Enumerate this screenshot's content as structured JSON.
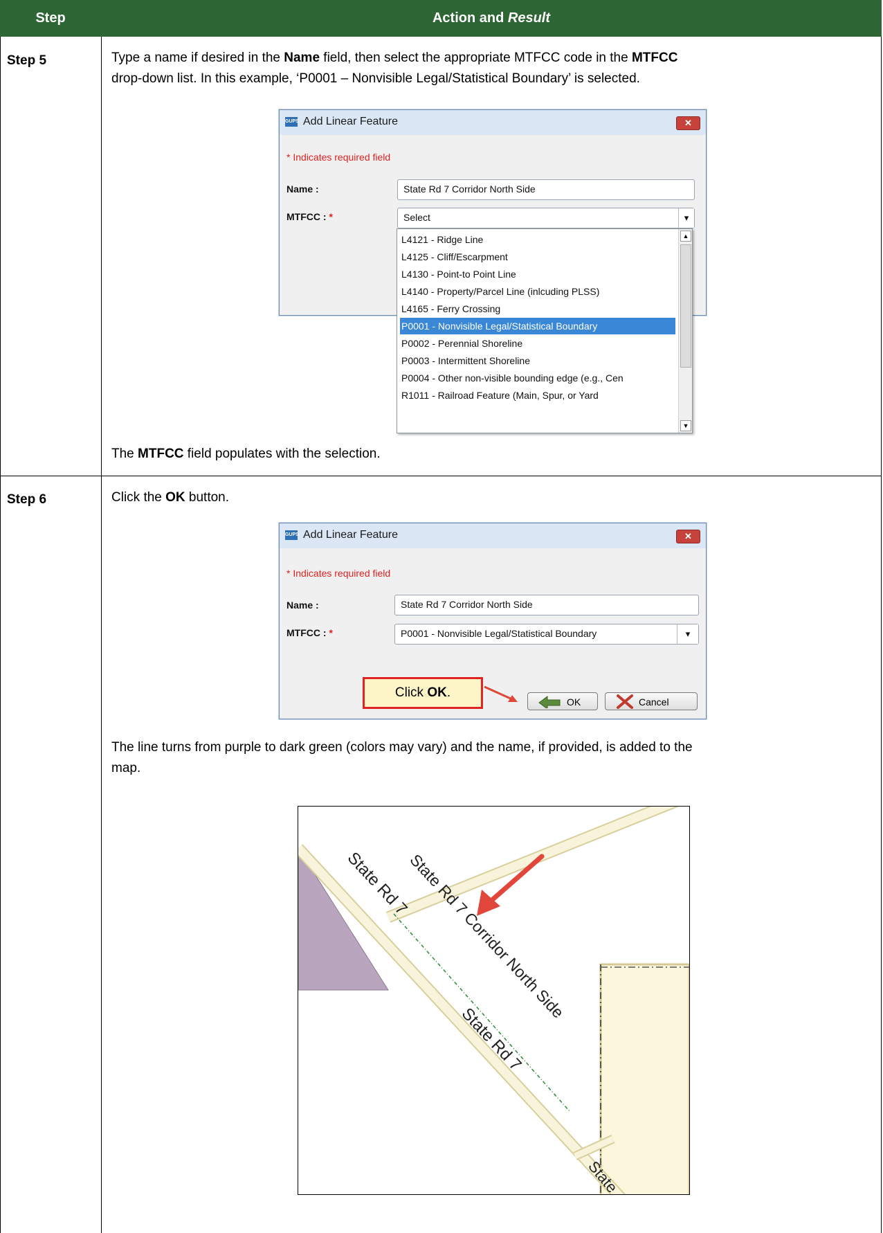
{
  "header": {
    "step": "Step",
    "action_prefix": "Action and ",
    "action_italic": "Result"
  },
  "step5": {
    "label": "Step 5",
    "para1_a": "Type a name if desired in the ",
    "para1_b": "Name",
    "para1_c": " field, then select the appropriate MTFCC code in the ",
    "para1_d": "MTFCC",
    "para1_e": "drop-down list. In this example, ‘P0001 – Nonvisible Legal/Statistical Boundary’ is selected.",
    "dialog": {
      "icon": "GUPS",
      "title": "Add Linear Feature",
      "required_note": "* Indicates required field",
      "name_label": "Name :",
      "name_value": "State Rd 7 Corridor North Side",
      "mtfcc_label": "MTFCC : ",
      "mtfcc_value": "Select",
      "options": [
        "L4121 - Ridge Line",
        "L4125 - Cliff/Escarpment",
        "L4130 - Point-to Point Line",
        "L4140 - Property/Parcel Line (inlcuding PLSS)",
        "L4165 - Ferry Crossing",
        "P0001 - Nonvisible Legal/Statistical Boundary",
        "P0002 - Perennial Shoreline",
        "P0003 - Intermittent Shoreline",
        "P0004 - Other non-visible bounding edge (e.g., Cen",
        "R1011 - Railroad Feature (Main, Spur, or Yard"
      ],
      "selected_index": 5
    },
    "result_a": "The ",
    "result_b": "MTFCC",
    "result_c": " field populates with the selection."
  },
  "step6": {
    "label": "Step 6",
    "para_a": "Click the ",
    "para_b": "OK",
    "para_c": " button.",
    "dialog": {
      "icon": "GUPS",
      "title": "Add Linear Feature",
      "required_note": "* Indicates required field",
      "name_label": "Name :",
      "name_value": "State Rd 7 Corridor North Side",
      "mtfcc_label": "MTFCC : ",
      "mtfcc_value": "P0001 - Nonvisible Legal/Statistical Boundary",
      "callout_a": "Click ",
      "callout_b": "OK",
      "callout_c": ".",
      "ok_label": "OK",
      "cancel_label": "Cancel"
    },
    "result_line1": "The line turns from purple to dark green (colors may vary) and the name, if provided, is added to the",
    "result_line2": "map.",
    "map": {
      "road_label_1": "State Rd 7",
      "road_label_2": "State Rd 7 Corridor North Side",
      "road_label_3": "State Rd 7",
      "road_label_4": "State"
    }
  },
  "colors": {
    "header_bg": "#2e6534",
    "selection": "#3a87d6",
    "callout_border": "#e02424",
    "arrow": "#e0463a"
  }
}
